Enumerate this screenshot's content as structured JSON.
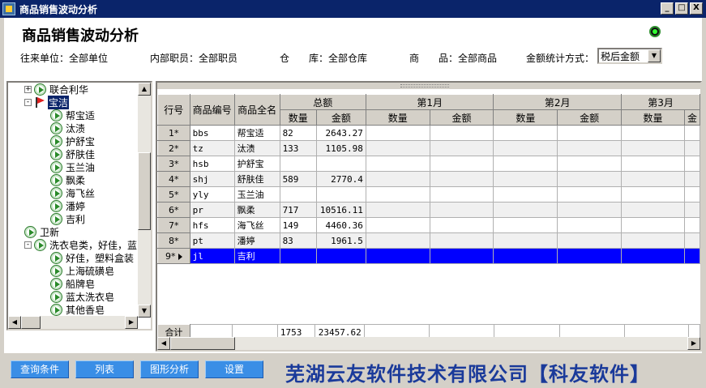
{
  "window": {
    "title": "商品销售波动分析",
    "buttons": [
      "_",
      "□",
      "X"
    ]
  },
  "page_title": "商品销售波动分析",
  "filters": {
    "unit": "往来单位：全部单位",
    "staff": "内部职员：全部职员",
    "warehouse": "仓　　库：全部仓库",
    "product": "商　　品：全部商品",
    "amount_mode_label": "金额统计方式：",
    "amount_mode_value": "税后金额"
  },
  "tree": [
    {
      "label": "联合利华",
      "level": 0,
      "expander": "+",
      "icon": "play-circle-icon"
    },
    {
      "label": "宝洁",
      "level": 0,
      "expander": "-",
      "icon": "red-flag-icon",
      "selected": true
    },
    {
      "label": "帮宝适",
      "level": 1,
      "icon": "play-circle-icon"
    },
    {
      "label": "汰渍",
      "level": 1,
      "icon": "play-circle-icon"
    },
    {
      "label": "护舒宝",
      "level": 1,
      "icon": "play-circle-icon"
    },
    {
      "label": "舒肤佳",
      "level": 1,
      "icon": "play-circle-icon"
    },
    {
      "label": "玉兰油",
      "level": 1,
      "icon": "play-circle-icon"
    },
    {
      "label": "飘柔",
      "level": 1,
      "icon": "play-circle-icon"
    },
    {
      "label": "海飞丝",
      "level": 1,
      "icon": "play-circle-icon"
    },
    {
      "label": "潘婷",
      "level": 1,
      "icon": "play-circle-icon"
    },
    {
      "label": "吉利",
      "level": 1,
      "icon": "play-circle-icon"
    },
    {
      "label": "卫新",
      "level": 0,
      "icon": "play-circle-icon"
    },
    {
      "label": "洗衣皂类，好佳，蓝",
      "level": 0,
      "expander": "-",
      "icon": "play-circle-icon"
    },
    {
      "label": "好佳，塑料盒装",
      "level": 1,
      "icon": "play-circle-icon"
    },
    {
      "label": "上海硫磺皂",
      "level": 1,
      "icon": "play-circle-icon"
    },
    {
      "label": "船牌皂",
      "level": 1,
      "icon": "play-circle-icon"
    },
    {
      "label": "蓝太洗衣皂",
      "level": 1,
      "icon": "play-circle-icon"
    },
    {
      "label": "其他香皂",
      "level": 1,
      "icon": "play-circle-icon"
    }
  ],
  "grid": {
    "headers": {
      "row_no": "行号",
      "code": "商品编号",
      "name": "商品全名",
      "groups": [
        "总额",
        "第1月",
        "第2月",
        "第3月"
      ],
      "qty": "数量",
      "amount": "金额",
      "cut": "金"
    },
    "rows": [
      {
        "no": "1*",
        "code": "bbs",
        "name": "帮宝适",
        "qty": "82",
        "amount": "2643.27"
      },
      {
        "no": "2*",
        "code": "tz",
        "name": "汰渍",
        "qty": "133",
        "amount": "1105.98"
      },
      {
        "no": "3*",
        "code": "hsb",
        "name": "护舒宝",
        "qty": "",
        "amount": ""
      },
      {
        "no": "4*",
        "code": "shj",
        "name": "舒肤佳",
        "qty": "589",
        "amount": "2770.4"
      },
      {
        "no": "5*",
        "code": "yly",
        "name": "玉兰油",
        "qty": "",
        "amount": ""
      },
      {
        "no": "6*",
        "code": "pr",
        "name": "飘柔",
        "qty": "717",
        "amount": "10516.11"
      },
      {
        "no": "7*",
        "code": "hfs",
        "name": "海飞丝",
        "qty": "149",
        "amount": "4460.36"
      },
      {
        "no": "8*",
        "code": "pt",
        "name": "潘婷",
        "qty": "83",
        "amount": "1961.5"
      },
      {
        "no": "9*",
        "code": "jl",
        "name": "吉利",
        "qty": "",
        "amount": "",
        "selected": true
      }
    ],
    "total": {
      "label": "合计",
      "qty": "1753",
      "amount": "23457.62"
    }
  },
  "buttons": {
    "query": "查询条件",
    "list": "列表",
    "chart": "图形分析",
    "settings": "设置"
  },
  "company": "芜湖云友软件技术有限公司【科友软件】",
  "colors": {
    "accent": "#0a246a",
    "selection": "#0000ff",
    "button": "#3a8ee6",
    "company_text": "#1a3a9a"
  }
}
